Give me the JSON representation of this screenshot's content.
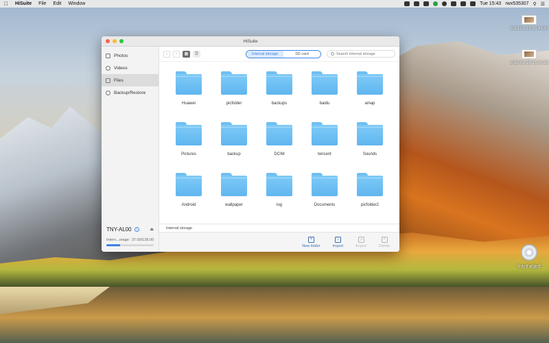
{
  "menubar": {
    "app_name": "HiSuite",
    "menus": [
      "File",
      "Edit",
      "Window"
    ],
    "clock": "Tue 15:43",
    "user": "rwx535307"
  },
  "desktop": {
    "items": [
      {
        "label": "2018-01-25 15.43.30",
        "icon": "image-thumbnail-icon"
      },
      {
        "label": "2018-01-25 15.43.28",
        "icon": "image-thumbnail-icon"
      },
      {
        "label": "华为手机助手",
        "icon": "disc-icon"
      }
    ]
  },
  "window": {
    "title": "HiSuite",
    "sidebar": {
      "items": [
        {
          "label": "Photos",
          "icon": "photos-icon",
          "active": false
        },
        {
          "label": "Videos",
          "icon": "videos-icon",
          "active": false
        },
        {
          "label": "Files",
          "icon": "files-icon",
          "active": true
        },
        {
          "label": "Backup/Restore",
          "icon": "backup-icon",
          "active": false
        }
      ],
      "device": {
        "name": "TNY-AL00",
        "storage_label": "Intern...orage:",
        "storage_value": "37.00/128.00",
        "storage_fraction": 0.29
      }
    },
    "toolbar": {
      "tabs": [
        "Internal storage",
        "SD card"
      ],
      "active_tab": 0,
      "search_placeholder": "Search internal storage"
    },
    "folders": [
      "Huawei",
      "picfolder",
      "backups",
      "baidu",
      "amap",
      "Pictures",
      "backup",
      "DCIM",
      "tencent",
      "Sounds",
      "Android",
      "wallpaper",
      "log",
      "Documents",
      "picfolder2"
    ],
    "path": "Internal storage",
    "actions": [
      {
        "label": "New folder",
        "icon": "new-folder-icon",
        "enabled": true
      },
      {
        "label": "Import",
        "icon": "import-icon",
        "enabled": true
      },
      {
        "label": "Export",
        "icon": "export-icon",
        "enabled": false
      },
      {
        "label": "Delete",
        "icon": "delete-icon",
        "enabled": false
      }
    ]
  }
}
